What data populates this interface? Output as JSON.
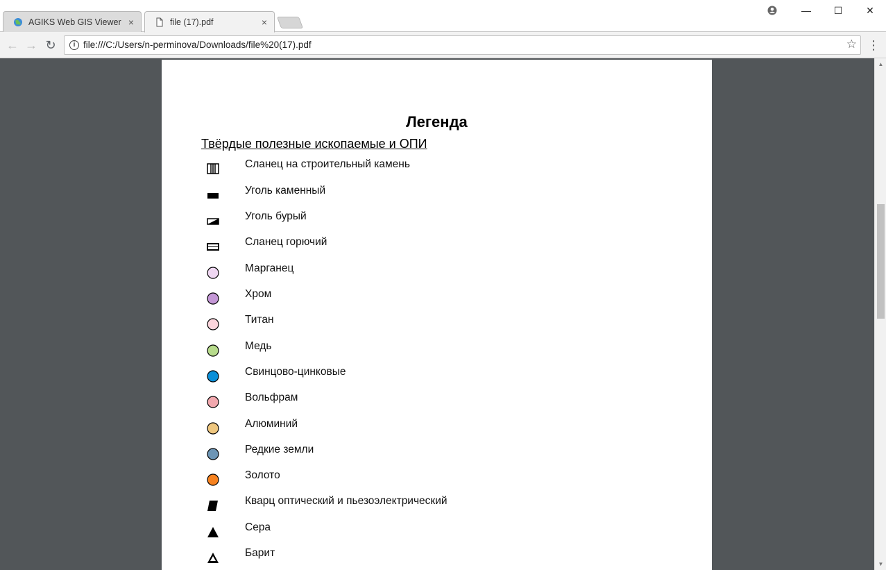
{
  "tabs": [
    {
      "label": "AGIKS Web GIS Viewer",
      "close": "×",
      "icon": "globe-icon"
    },
    {
      "label": "file (17).pdf",
      "close": "×",
      "icon": "document-icon"
    }
  ],
  "window_controls": {
    "minimize": "—",
    "maximize": "☐",
    "close": "✕",
    "profile": "profile-icon"
  },
  "toolbar": {
    "back": "←",
    "forward": "→",
    "reload": "↻",
    "info": "i",
    "url": "file:///C:/Users/n-perminova/Downloads/file%20(17).pdf",
    "star": "☆",
    "menu": "⋮"
  },
  "pdf": {
    "title": "Легенда",
    "section": "Твёрдые полезные ископаемые и ОПИ",
    "items": [
      {
        "label": "Сланец на строительный камень",
        "symbol": "vertical-bars-rect",
        "color": "#000000"
      },
      {
        "label": "Уголь каменный",
        "symbol": "filled-rect",
        "color": "#000000"
      },
      {
        "label": "Уголь бурый",
        "symbol": "half-filled-rect",
        "color": "#000000"
      },
      {
        "label": "Сланец горючий",
        "symbol": "striped-rect",
        "color": "#000000"
      },
      {
        "label": "Марганец",
        "symbol": "circle",
        "color": "#efd7f2"
      },
      {
        "label": "Хром",
        "symbol": "circle",
        "color": "#c497d6"
      },
      {
        "label": "Титан",
        "symbol": "circle",
        "color": "#fbd5dc"
      },
      {
        "label": "Медь",
        "symbol": "circle",
        "color": "#b7db8b"
      },
      {
        "label": "Свинцово-цинковые",
        "symbol": "circle",
        "color": "#0b8fd8"
      },
      {
        "label": "Вольфрам",
        "symbol": "circle",
        "color": "#f2a8ae"
      },
      {
        "label": "Алюминий",
        "symbol": "circle",
        "color": "#efc77f"
      },
      {
        "label": "Редкие земли",
        "symbol": "circle",
        "color": "#6d95b5"
      },
      {
        "label": "Золото",
        "symbol": "circle",
        "color": "#f7821f"
      },
      {
        "label": "Кварц оптический и пьезоэлектрический",
        "symbol": "parallelogram",
        "color": "#000000"
      },
      {
        "label": "Сера",
        "symbol": "filled-triangle",
        "color": "#000000"
      },
      {
        "label": "Барит",
        "symbol": "outline-triangle",
        "color": "#000000"
      }
    ]
  }
}
